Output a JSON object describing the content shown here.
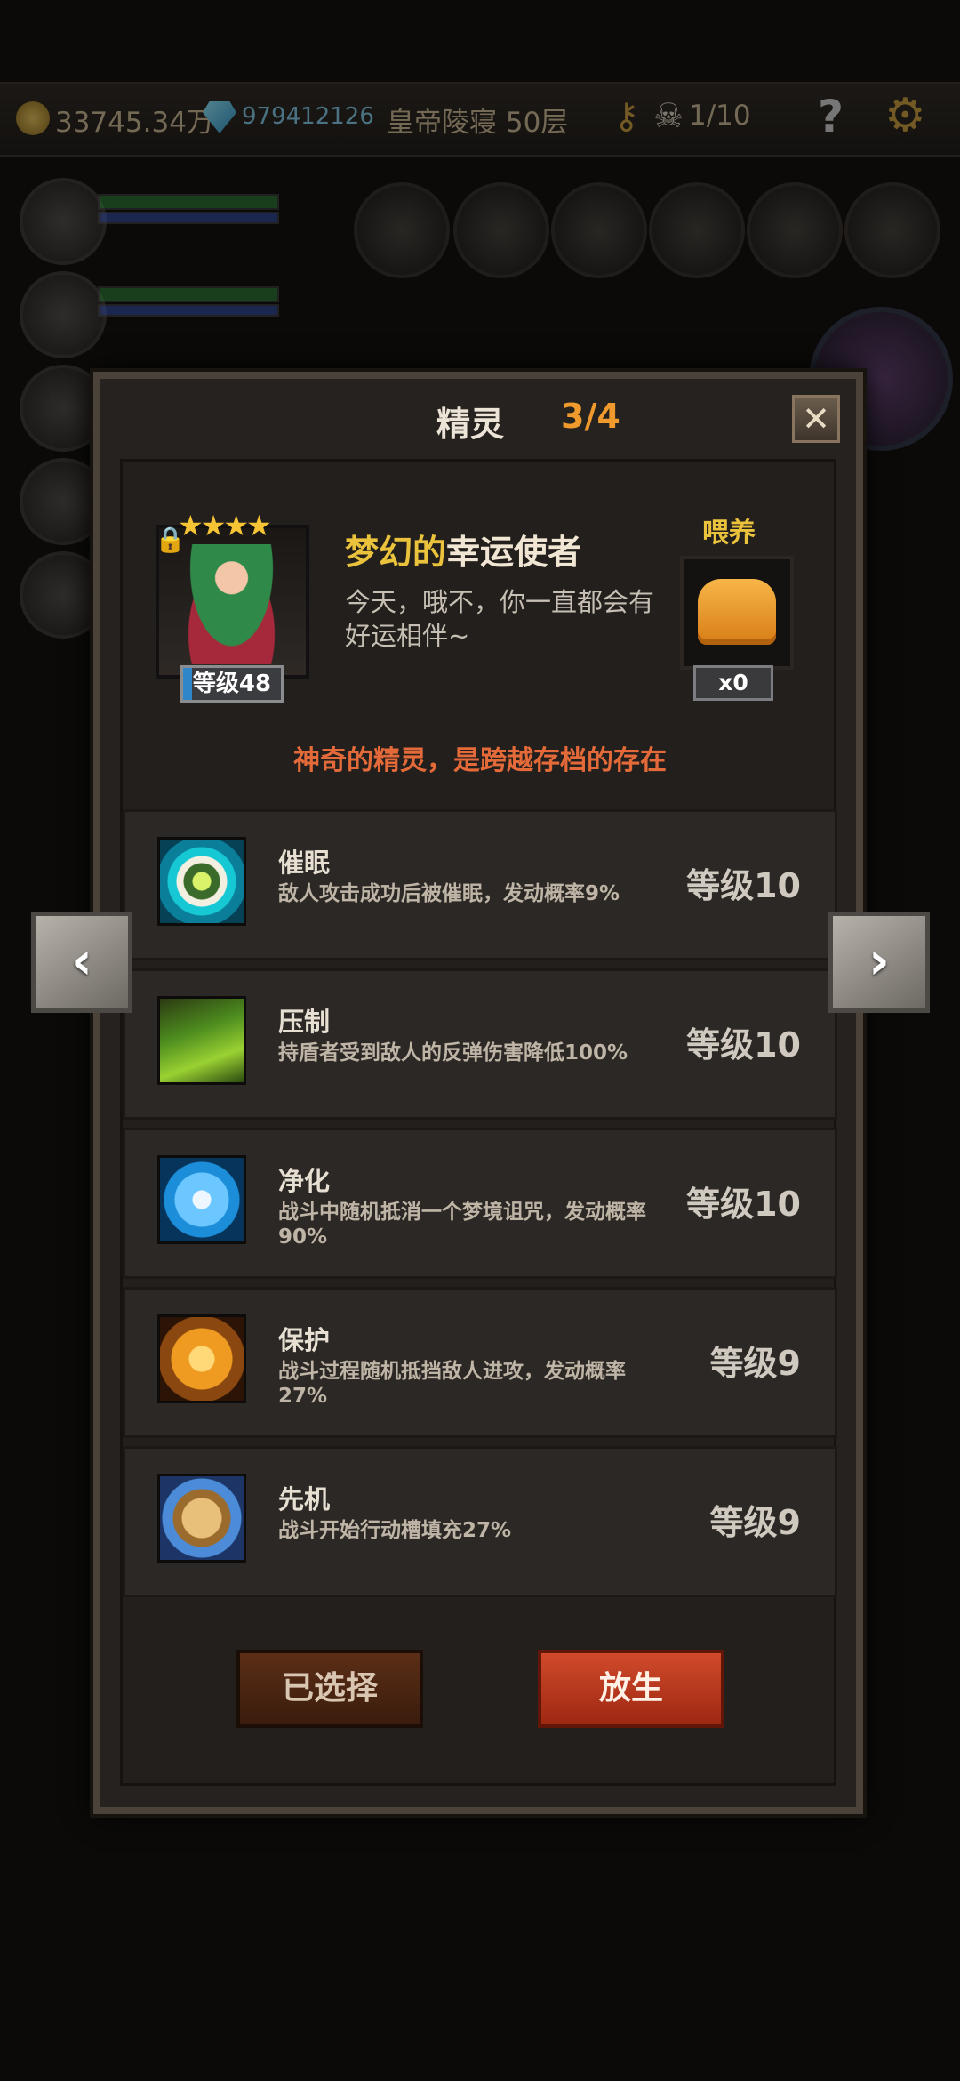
{
  "hud": {
    "gold": "33745.34万",
    "gems": "979412126",
    "location": "皇帝陵寝 50层",
    "kills": "1/10",
    "help_label": "?"
  },
  "modal": {
    "title": "精灵",
    "counter": "3/4",
    "close_label": "✕"
  },
  "pet": {
    "name_adj": "梦幻的",
    "name_noun": "幸运使者",
    "description": "今天，哦不，你一直都会有好运相伴~",
    "stars": 4,
    "star_text": "★★★★",
    "level": "等级48",
    "feed_label": "喂养",
    "feed_count": "x0",
    "tagline": "神奇的精灵，是跨越存档的存在"
  },
  "skills": [
    {
      "name": "催眠",
      "desc": "敌人攻击成功后被催眠，发动概率9%",
      "level": "等级10",
      "icon": "eye-icon"
    },
    {
      "name": "压制",
      "desc": "持盾者受到敌人的反弹伤害降低100%",
      "level": "等级10",
      "icon": "claw-icon"
    },
    {
      "name": "净化",
      "desc": "战斗中随机抵消一个梦境诅咒，发动概率90%",
      "level": "等级10",
      "icon": "flower-icon"
    },
    {
      "name": "保护",
      "desc": "战斗过程随机抵挡敌人进攻，发动概率27%",
      "level": "等级9",
      "icon": "guardian-icon"
    },
    {
      "name": "先机",
      "desc": "战斗开始行动槽填充27%",
      "level": "等级9",
      "icon": "leopard-icon"
    }
  ],
  "nav": {
    "prev": "‹",
    "next": "›"
  },
  "buttons": {
    "selected": "已选择",
    "release": "放生"
  },
  "colors": {
    "accent_orange": "#f09a2d",
    "gold_text": "#eac23c",
    "tagline": "#e56a3a",
    "release_red": "#c23a20"
  }
}
